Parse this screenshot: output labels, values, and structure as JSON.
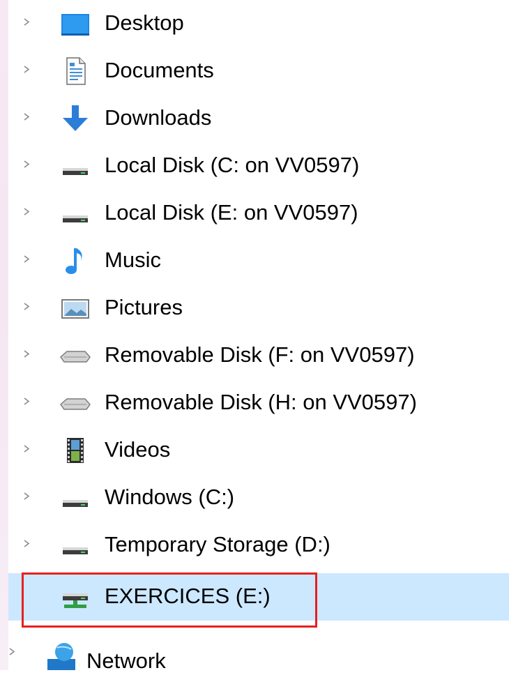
{
  "nav_tree": {
    "items": [
      {
        "label": "Desktop",
        "icon": "desktop-icon",
        "has_chevron": true,
        "selected": false
      },
      {
        "label": "Documents",
        "icon": "documents-icon",
        "has_chevron": true,
        "selected": false
      },
      {
        "label": "Downloads",
        "icon": "downloads-icon",
        "has_chevron": true,
        "selected": false
      },
      {
        "label": "Local Disk (C: on VV0597)",
        "icon": "drive-icon",
        "has_chevron": true,
        "selected": false
      },
      {
        "label": "Local Disk (E: on VV0597)",
        "icon": "drive-icon",
        "has_chevron": true,
        "selected": false
      },
      {
        "label": "Music",
        "icon": "music-icon",
        "has_chevron": true,
        "selected": false
      },
      {
        "label": "Pictures",
        "icon": "pictures-icon",
        "has_chevron": true,
        "selected": false
      },
      {
        "label": "Removable Disk (F: on VV0597)",
        "icon": "removable-disk-icon",
        "has_chevron": true,
        "selected": false
      },
      {
        "label": "Removable Disk (H: on VV0597)",
        "icon": "removable-disk-icon",
        "has_chevron": true,
        "selected": false
      },
      {
        "label": "Videos",
        "icon": "videos-icon",
        "has_chevron": true,
        "selected": false
      },
      {
        "label": "Windows (C:)",
        "icon": "drive-icon",
        "has_chevron": true,
        "selected": false
      },
      {
        "label": "Temporary Storage (D:)",
        "icon": "drive-icon",
        "has_chevron": true,
        "selected": false
      },
      {
        "label": "EXERCICES (E:)",
        "icon": "network-drive-icon",
        "has_chevron": false,
        "selected": true
      },
      {
        "label": "Network",
        "icon": "network-icon",
        "has_chevron": true,
        "selected": false
      }
    ]
  },
  "colors": {
    "selection_background": "#cce8ff",
    "highlight_border": "#e5211f"
  }
}
